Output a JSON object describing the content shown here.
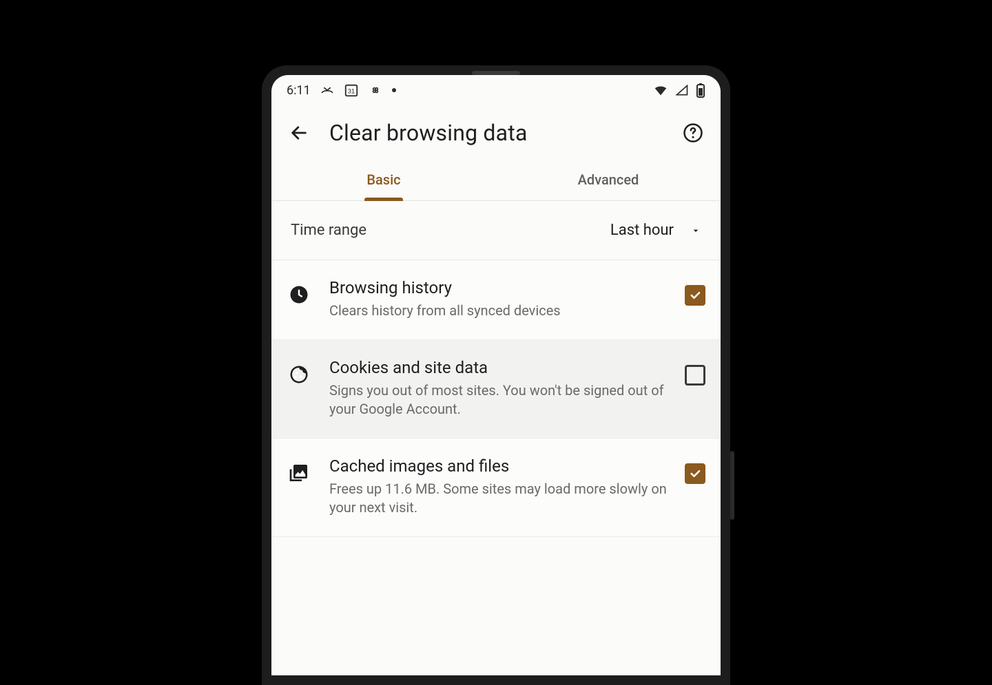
{
  "status": {
    "time": "6:11",
    "calendar_day": "31"
  },
  "header": {
    "title": "Clear browsing data"
  },
  "tabs": [
    {
      "label": "Basic",
      "active": true
    },
    {
      "label": "Advanced",
      "active": false
    }
  ],
  "time_range": {
    "label": "Time range",
    "value": "Last hour"
  },
  "items": [
    {
      "icon": "clock",
      "title": "Browsing history",
      "desc": "Clears history from all synced devices",
      "checked": true,
      "highlight": false
    },
    {
      "icon": "cookie",
      "title": "Cookies and site data",
      "desc": "Signs you out of most sites. You won't be signed out of your Google Account.",
      "checked": false,
      "highlight": true
    },
    {
      "icon": "image-stack",
      "title": "Cached images and files",
      "desc": "Frees up 11.6 MB. Some sites may load more slowly on your next visit.",
      "checked": true,
      "highlight": false
    }
  ]
}
